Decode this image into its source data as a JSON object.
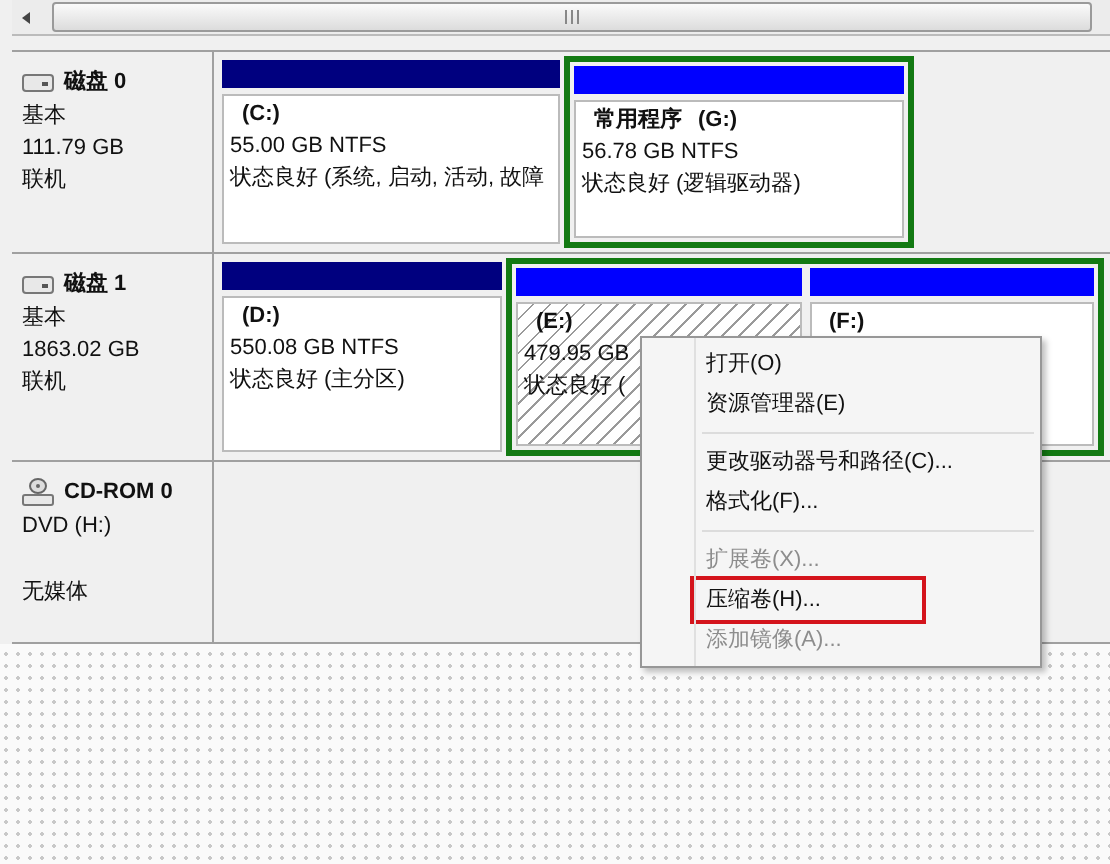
{
  "disks": [
    {
      "kind": "disk",
      "name": "磁盘 0",
      "type": "基本",
      "size": "111.79 GB",
      "status": "联机",
      "partitions": [
        {
          "kind": "primary",
          "label": "(C:)",
          "size": "55.00 GB NTFS",
          "status": "状态良好 (系统, 启动, 活动, 故障",
          "selected": false
        },
        {
          "kind": "extended",
          "children": [
            {
              "kind": "logical",
              "name": "常用程序",
              "label": "(G:)",
              "size": "56.78 GB NTFS",
              "status": "状态良好 (逻辑驱动器)",
              "selected": false
            }
          ]
        }
      ]
    },
    {
      "kind": "disk",
      "name": "磁盘 1",
      "type": "基本",
      "size": "1863.02 GB",
      "status": "联机",
      "partitions": [
        {
          "kind": "primary",
          "label": "(D:)",
          "size": "550.08 GB NTFS",
          "status": "状态良好 (主分区)",
          "selected": false
        },
        {
          "kind": "extended",
          "children": [
            {
              "kind": "logical",
              "label": "(E:)",
              "size": "479.95 GB",
              "status": "状态良好 (",
              "selected": true
            },
            {
              "kind": "logical",
              "label": "(F:)",
              "selected": false
            }
          ]
        }
      ]
    },
    {
      "kind": "cdrom",
      "name": "CD-ROM 0",
      "type": "DVD (H:)",
      "status": "无媒体"
    }
  ],
  "context_menu": [
    {
      "kind": "item",
      "label": "打开(O)",
      "disabled": false,
      "highlighted": false
    },
    {
      "kind": "item",
      "label": "资源管理器(E)",
      "disabled": false,
      "highlighted": false
    },
    {
      "kind": "separator"
    },
    {
      "kind": "item",
      "label": "更改驱动器号和路径(C)...",
      "disabled": false,
      "highlighted": false
    },
    {
      "kind": "item",
      "label": "格式化(F)...",
      "disabled": false,
      "highlighted": false
    },
    {
      "kind": "separator"
    },
    {
      "kind": "item",
      "label": "扩展卷(X)...",
      "disabled": true,
      "highlighted": false
    },
    {
      "kind": "item",
      "label": "压缩卷(H)...",
      "disabled": false,
      "highlighted": true
    },
    {
      "kind": "item",
      "label": "添加镜像(A)...",
      "disabled": true,
      "highlighted": false
    }
  ]
}
